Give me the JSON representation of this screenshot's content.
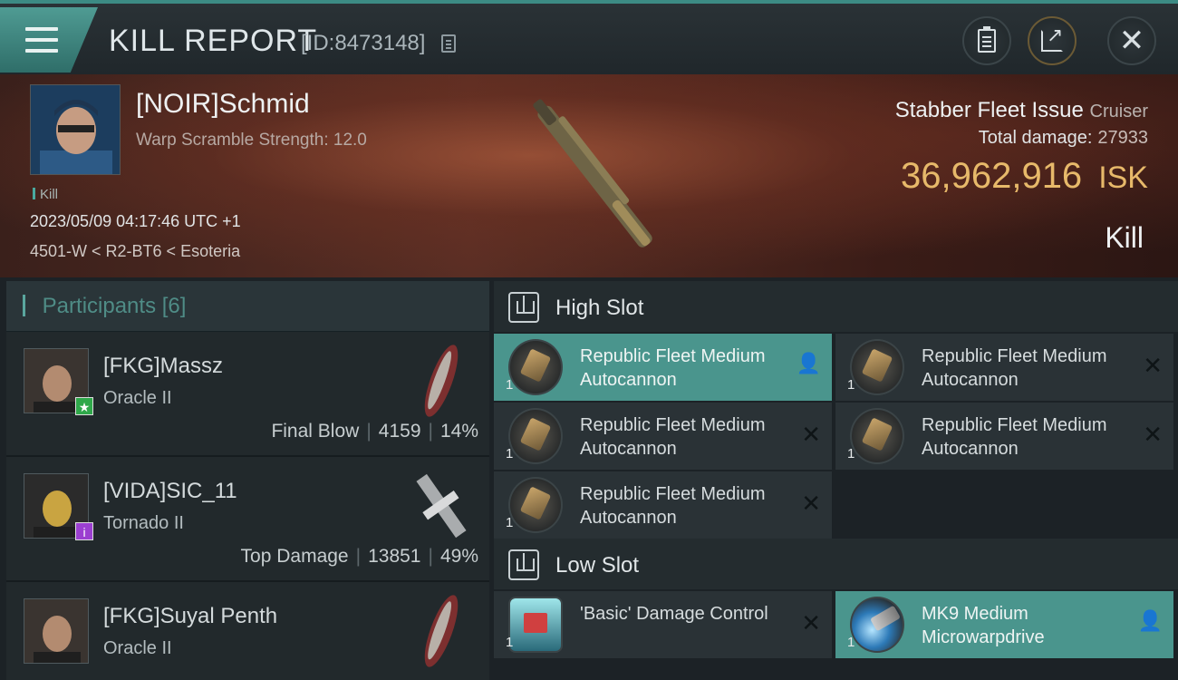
{
  "header": {
    "title": "KILL REPORT",
    "report_id": "[ID:8473148]"
  },
  "victim": {
    "name": "[NOIR]Schmid",
    "stat": "Warp Scramble Strength: 12.0",
    "tag": "Kill",
    "timestamp": "2023/05/09 04:17:46 UTC +1",
    "location": "4501-W < R2-BT6 < Esoteria",
    "ship": "Stabber Fleet Issue",
    "ship_class": "Cruiser",
    "damage_label": "Total damage:",
    "damage_value": "27933",
    "isk_value": "36,962,916",
    "isk_unit": "ISK",
    "result": "Kill"
  },
  "participants": {
    "label": "Participants",
    "count": "[6]",
    "rows": [
      {
        "name": "[FKG]Massz",
        "ship": "Oracle II",
        "role": "Final Blow",
        "damage": "4159",
        "percent": "14%",
        "badge": "★",
        "badge_color": "#2fa84a"
      },
      {
        "name": "[VIDA]SIC_11",
        "ship": "Tornado II",
        "role": "Top Damage",
        "damage": "13851",
        "percent": "49%",
        "badge": "i",
        "badge_color": "#9b3fd0"
      },
      {
        "name": "[FKG]Suyal Penth",
        "ship": "Oracle II",
        "role": "",
        "damage": "",
        "percent": "",
        "badge": "",
        "badge_color": ""
      }
    ]
  },
  "slots": {
    "high_label": "High Slot",
    "low_label": "Low Slot",
    "high": [
      {
        "qty": "1",
        "name": "Republic Fleet Medium Autocannon",
        "state": "person-icon",
        "active": true
      },
      {
        "qty": "1",
        "name": "Republic Fleet Medium Autocannon",
        "state": "close-icon",
        "active": false
      },
      {
        "qty": "1",
        "name": "Republic Fleet Medium Autocannon",
        "state": "close-icon",
        "active": false
      },
      {
        "qty": "1",
        "name": "Republic Fleet Medium Autocannon",
        "state": "close-icon",
        "active": false
      },
      {
        "qty": "1",
        "name": "Republic Fleet Medium Autocannon",
        "state": "close-icon",
        "active": false
      }
    ],
    "low": [
      {
        "qty": "1",
        "name": "'Basic' Damage Control",
        "state": "close-icon",
        "active": false
      },
      {
        "qty": "1",
        "name": "MK9 Medium Microwarpdrive",
        "state": "person-icon",
        "active": true
      }
    ]
  },
  "colors": {
    "accent": "#4a958d",
    "isk": "#e7b96a"
  }
}
